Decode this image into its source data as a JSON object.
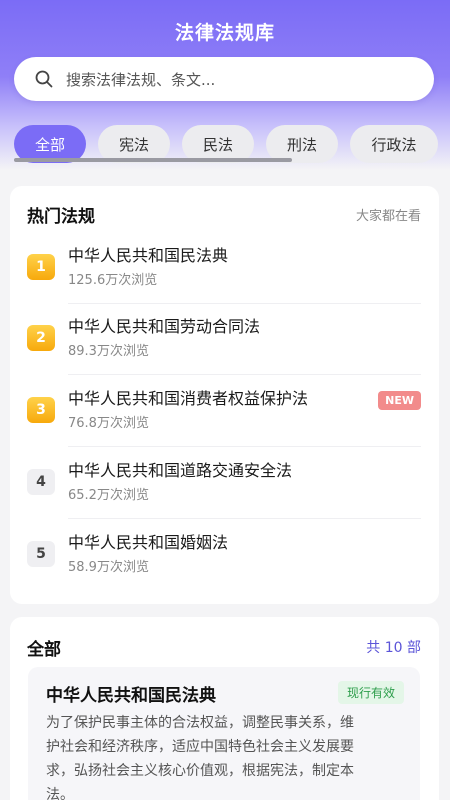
{
  "app": {
    "title": "法律法规库"
  },
  "search": {
    "placeholder": "搜索法律法规、条文..."
  },
  "tabs": [
    {
      "label": "全部",
      "active": true
    },
    {
      "label": "宪法",
      "active": false
    },
    {
      "label": "民法",
      "active": false
    },
    {
      "label": "刑法",
      "active": false
    },
    {
      "label": "行政法",
      "active": false
    }
  ],
  "hot": {
    "title": "热门法规",
    "subtitle": "大家都在看",
    "items": [
      {
        "rank": "1",
        "name": "中华人民共和国民法典",
        "views": "125.6万次浏览",
        "badge": ""
      },
      {
        "rank": "2",
        "name": "中华人民共和国劳动合同法",
        "views": "89.3万次浏览",
        "badge": ""
      },
      {
        "rank": "3",
        "name": "中华人民共和国消费者权益保护法",
        "views": "76.8万次浏览",
        "badge": "NEW"
      },
      {
        "rank": "4",
        "name": "中华人民共和国道路交通安全法",
        "views": "65.2万次浏览",
        "badge": ""
      },
      {
        "rank": "5",
        "name": "中华人民共和国婚姻法",
        "views": "58.9万次浏览",
        "badge": ""
      }
    ]
  },
  "all": {
    "title": "全部",
    "count": "共 10 部",
    "first": {
      "title": "中华人民共和国民法典",
      "status": "现行有效",
      "desc_lines": [
        "为了保护民事主体的合法权益，调整民事关系，维",
        "护社会和经济秩序，适应中国特色社会主义发展要",
        "求，弘扬社会主义核心价值观，根据宪法，制定本",
        "法。"
      ]
    }
  },
  "colors": {
    "accent": "#7b6cf6",
    "gold": "#f7a90c",
    "new": "#f28b8b",
    "status_green": "#2e9e4c"
  }
}
